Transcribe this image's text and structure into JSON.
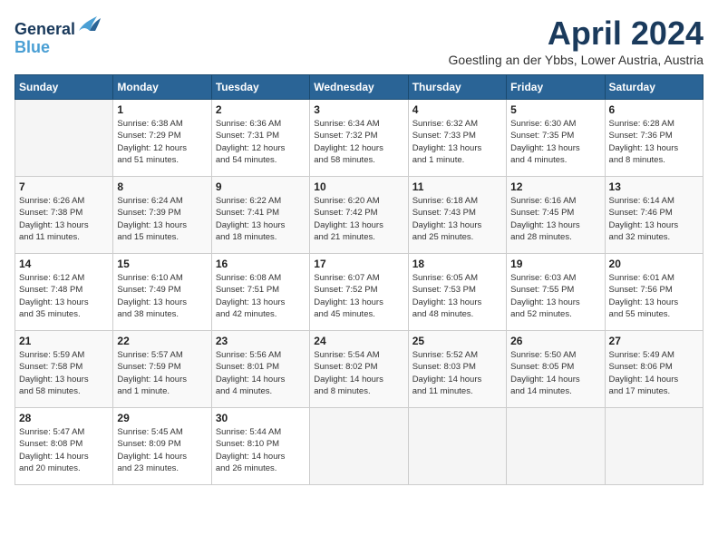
{
  "header": {
    "logo_line1": "General",
    "logo_line2": "Blue",
    "month_title": "April 2024",
    "location": "Goestling an der Ybbs, Lower Austria, Austria"
  },
  "days_of_week": [
    "Sunday",
    "Monday",
    "Tuesday",
    "Wednesday",
    "Thursday",
    "Friday",
    "Saturday"
  ],
  "weeks": [
    [
      {
        "day": "",
        "info": ""
      },
      {
        "day": "1",
        "info": "Sunrise: 6:38 AM\nSunset: 7:29 PM\nDaylight: 12 hours\nand 51 minutes."
      },
      {
        "day": "2",
        "info": "Sunrise: 6:36 AM\nSunset: 7:31 PM\nDaylight: 12 hours\nand 54 minutes."
      },
      {
        "day": "3",
        "info": "Sunrise: 6:34 AM\nSunset: 7:32 PM\nDaylight: 12 hours\nand 58 minutes."
      },
      {
        "day": "4",
        "info": "Sunrise: 6:32 AM\nSunset: 7:33 PM\nDaylight: 13 hours\nand 1 minute."
      },
      {
        "day": "5",
        "info": "Sunrise: 6:30 AM\nSunset: 7:35 PM\nDaylight: 13 hours\nand 4 minutes."
      },
      {
        "day": "6",
        "info": "Sunrise: 6:28 AM\nSunset: 7:36 PM\nDaylight: 13 hours\nand 8 minutes."
      }
    ],
    [
      {
        "day": "7",
        "info": "Sunrise: 6:26 AM\nSunset: 7:38 PM\nDaylight: 13 hours\nand 11 minutes."
      },
      {
        "day": "8",
        "info": "Sunrise: 6:24 AM\nSunset: 7:39 PM\nDaylight: 13 hours\nand 15 minutes."
      },
      {
        "day": "9",
        "info": "Sunrise: 6:22 AM\nSunset: 7:41 PM\nDaylight: 13 hours\nand 18 minutes."
      },
      {
        "day": "10",
        "info": "Sunrise: 6:20 AM\nSunset: 7:42 PM\nDaylight: 13 hours\nand 21 minutes."
      },
      {
        "day": "11",
        "info": "Sunrise: 6:18 AM\nSunset: 7:43 PM\nDaylight: 13 hours\nand 25 minutes."
      },
      {
        "day": "12",
        "info": "Sunrise: 6:16 AM\nSunset: 7:45 PM\nDaylight: 13 hours\nand 28 minutes."
      },
      {
        "day": "13",
        "info": "Sunrise: 6:14 AM\nSunset: 7:46 PM\nDaylight: 13 hours\nand 32 minutes."
      }
    ],
    [
      {
        "day": "14",
        "info": "Sunrise: 6:12 AM\nSunset: 7:48 PM\nDaylight: 13 hours\nand 35 minutes."
      },
      {
        "day": "15",
        "info": "Sunrise: 6:10 AM\nSunset: 7:49 PM\nDaylight: 13 hours\nand 38 minutes."
      },
      {
        "day": "16",
        "info": "Sunrise: 6:08 AM\nSunset: 7:51 PM\nDaylight: 13 hours\nand 42 minutes."
      },
      {
        "day": "17",
        "info": "Sunrise: 6:07 AM\nSunset: 7:52 PM\nDaylight: 13 hours\nand 45 minutes."
      },
      {
        "day": "18",
        "info": "Sunrise: 6:05 AM\nSunset: 7:53 PM\nDaylight: 13 hours\nand 48 minutes."
      },
      {
        "day": "19",
        "info": "Sunrise: 6:03 AM\nSunset: 7:55 PM\nDaylight: 13 hours\nand 52 minutes."
      },
      {
        "day": "20",
        "info": "Sunrise: 6:01 AM\nSunset: 7:56 PM\nDaylight: 13 hours\nand 55 minutes."
      }
    ],
    [
      {
        "day": "21",
        "info": "Sunrise: 5:59 AM\nSunset: 7:58 PM\nDaylight: 13 hours\nand 58 minutes."
      },
      {
        "day": "22",
        "info": "Sunrise: 5:57 AM\nSunset: 7:59 PM\nDaylight: 14 hours\nand 1 minute."
      },
      {
        "day": "23",
        "info": "Sunrise: 5:56 AM\nSunset: 8:01 PM\nDaylight: 14 hours\nand 4 minutes."
      },
      {
        "day": "24",
        "info": "Sunrise: 5:54 AM\nSunset: 8:02 PM\nDaylight: 14 hours\nand 8 minutes."
      },
      {
        "day": "25",
        "info": "Sunrise: 5:52 AM\nSunset: 8:03 PM\nDaylight: 14 hours\nand 11 minutes."
      },
      {
        "day": "26",
        "info": "Sunrise: 5:50 AM\nSunset: 8:05 PM\nDaylight: 14 hours\nand 14 minutes."
      },
      {
        "day": "27",
        "info": "Sunrise: 5:49 AM\nSunset: 8:06 PM\nDaylight: 14 hours\nand 17 minutes."
      }
    ],
    [
      {
        "day": "28",
        "info": "Sunrise: 5:47 AM\nSunset: 8:08 PM\nDaylight: 14 hours\nand 20 minutes."
      },
      {
        "day": "29",
        "info": "Sunrise: 5:45 AM\nSunset: 8:09 PM\nDaylight: 14 hours\nand 23 minutes."
      },
      {
        "day": "30",
        "info": "Sunrise: 5:44 AM\nSunset: 8:10 PM\nDaylight: 14 hours\nand 26 minutes."
      },
      {
        "day": "",
        "info": ""
      },
      {
        "day": "",
        "info": ""
      },
      {
        "day": "",
        "info": ""
      },
      {
        "day": "",
        "info": ""
      }
    ]
  ]
}
